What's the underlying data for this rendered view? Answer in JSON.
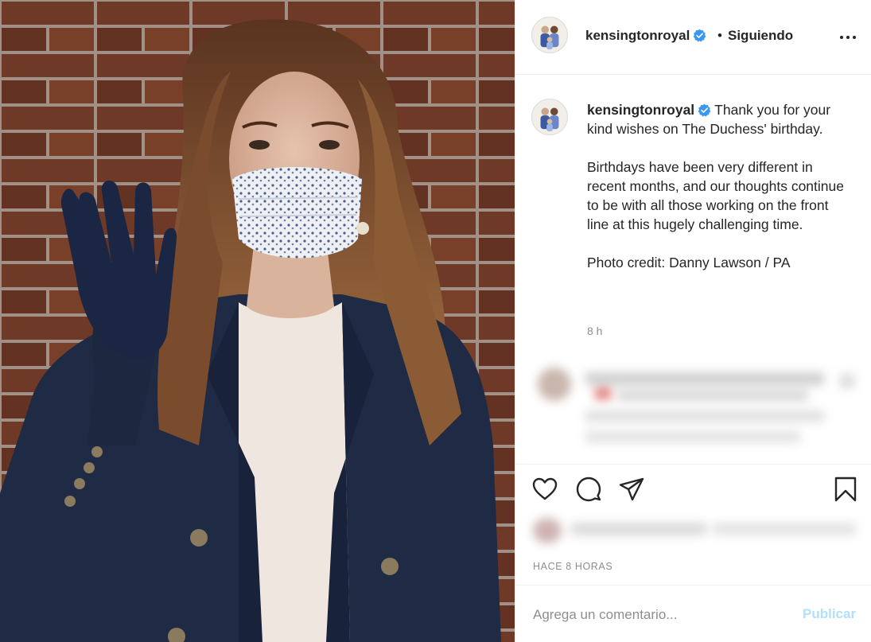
{
  "post": {
    "image_alt_subject": "woman-waving-with-face-mask",
    "header": {
      "username": "kensingtonroyal",
      "verified_icon": "verified-badge-icon",
      "separator": "•",
      "follow_status": "Siguiendo",
      "more_icon": "more-options-icon"
    },
    "caption": {
      "username": "kensingtonroyal",
      "line1": "Thank you for your kind wishes on The Duchess' birthday.",
      "paragraph2": "Birthdays have been very different in recent months, and our thoughts continue to be with all those working on the front line at this hugely challenging time.",
      "paragraph3": "Photo credit: Danny Lawson / PA",
      "time": "8 h"
    },
    "actions": {
      "like_icon": "heart-icon",
      "comment_icon": "comment-bubble-icon",
      "share_icon": "paper-plane-icon",
      "save_icon": "bookmark-icon"
    },
    "time_ago": "HACE 8 HORAS",
    "comment_box": {
      "placeholder": "Agrega un comentario...",
      "publish_label": "Publicar"
    }
  },
  "colors": {
    "verified": "#3897f0",
    "publish_disabled": "#b2dffc",
    "muted_text": "#8e8e8e",
    "text": "#262626",
    "divider": "#efefef"
  }
}
